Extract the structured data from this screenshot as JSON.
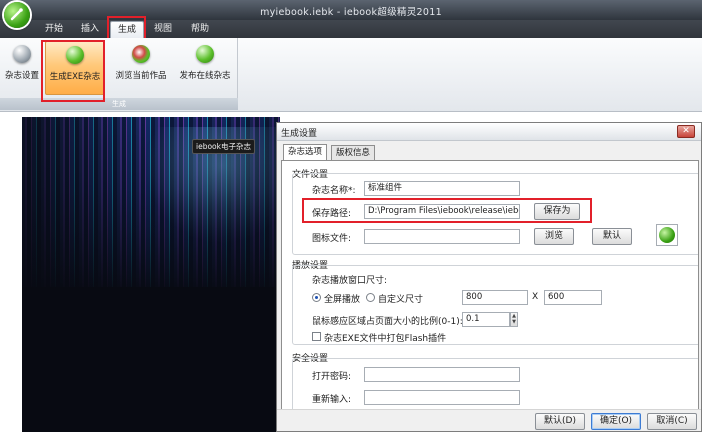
{
  "window": {
    "title": "myiebook.iebk - iebook超级精灵2011"
  },
  "tabs": {
    "t0": "开始",
    "t1": "插入",
    "t2": "生成",
    "t3": "视图",
    "t4": "帮助"
  },
  "ribbon": {
    "b0": "杂志设置",
    "b1": "生成EXE杂志",
    "b2": "浏览当前作品",
    "b3": "发布在线杂志",
    "group_label": "生成"
  },
  "preview": {
    "label": "iebook电子杂志"
  },
  "dialog": {
    "title": "生成设置",
    "tabs": {
      "t0": "杂志选项",
      "t1": "版权信息"
    },
    "file_settings": {
      "title": "文件设置",
      "name_label": "杂志名称*:",
      "name_value": "标准组件",
      "path_label": "保存路径:",
      "path_value": "D:\\Program Files\\iebook\\release\\iebook.exe",
      "save_as": "保存为",
      "icon_label": "图标文件:",
      "icon_value": "",
      "browse": "浏览",
      "default": "默认"
    },
    "play_settings": {
      "title": "播放设置",
      "window_size_label": "杂志播放窗口尺寸:",
      "fullscreen": "全屏播放",
      "custom_size": "自定义尺寸",
      "width": "800",
      "x": "X",
      "height": "600",
      "ratio_label": "鼠标感应区域占页面大小的比例(0-1):",
      "ratio_value": "0.1",
      "pack_flash": "杂志EXE文件中打包Flash插件"
    },
    "security": {
      "title": "安全设置",
      "open_password": "打开密码:",
      "reenter": "重新输入:"
    },
    "footer": {
      "default": "默认(D)",
      "ok": "确定(O)",
      "cancel": "取消(C)"
    }
  },
  "colors": {
    "highlight": "#e2202a",
    "accent_green": "#3aa114",
    "active_orange": "#ffad47"
  }
}
